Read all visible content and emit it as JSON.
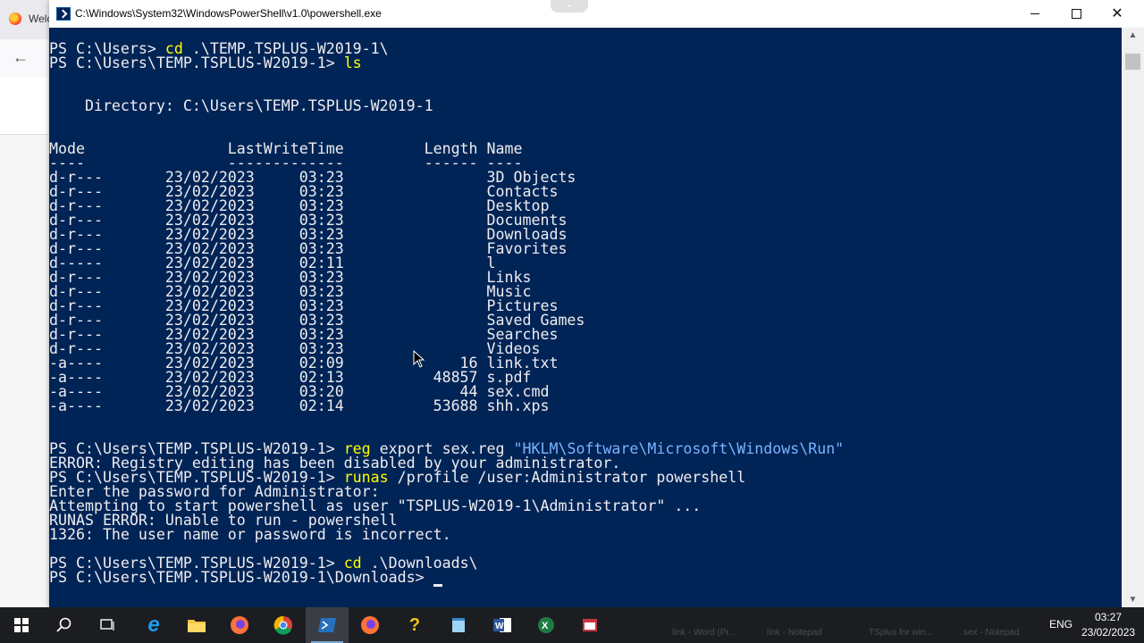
{
  "background_browser": {
    "tab_title": "Welc",
    "back_icon": "arrow-left-icon"
  },
  "window": {
    "title": "C:\\Windows\\System32\\WindowsPowerShell\\v1.0\\powershell.exe",
    "controls": {
      "minimize": "minimize-icon",
      "maximize": "maximize-icon",
      "close": "✕"
    }
  },
  "console": {
    "colors": {
      "background": "#012456",
      "text": "#eeedf0",
      "command": "#ffff00",
      "string": "#79b3ff"
    },
    "lines": [
      {
        "prompt": "",
        "rest": ""
      },
      {
        "prompt": "PS C:\\Users> ",
        "cmd": "cd",
        "rest": " .\\TEMP.TSPLUS-W2019-1\\"
      },
      {
        "prompt": "PS C:\\Users\\TEMP.TSPLUS-W2019-1> ",
        "cmd": "ls",
        "rest": ""
      },
      {
        "prompt": "",
        "rest": ""
      },
      {
        "prompt": "",
        "rest": ""
      },
      {
        "prompt": "",
        "rest": "    Directory: C:\\Users\\TEMP.TSPLUS-W2019-1"
      },
      {
        "prompt": "",
        "rest": ""
      },
      {
        "prompt": "",
        "rest": ""
      },
      {
        "prompt": "",
        "rest": "Mode                LastWriteTime         Length Name"
      },
      {
        "prompt": "",
        "rest": "----                -------------         ------ ----"
      },
      {
        "prompt": "",
        "rest": "d-r---       23/02/2023     03:23                3D Objects"
      },
      {
        "prompt": "",
        "rest": "d-r---       23/02/2023     03:23                Contacts"
      },
      {
        "prompt": "",
        "rest": "d-r---       23/02/2023     03:23                Desktop"
      },
      {
        "prompt": "",
        "rest": "d-r---       23/02/2023     03:23                Documents"
      },
      {
        "prompt": "",
        "rest": "d-r---       23/02/2023     03:23                Downloads"
      },
      {
        "prompt": "",
        "rest": "d-r---       23/02/2023     03:23                Favorites"
      },
      {
        "prompt": "",
        "rest": "d-----       23/02/2023     02:11                l"
      },
      {
        "prompt": "",
        "rest": "d-r---       23/02/2023     03:23                Links"
      },
      {
        "prompt": "",
        "rest": "d-r---       23/02/2023     03:23                Music"
      },
      {
        "prompt": "",
        "rest": "d-r---       23/02/2023     03:23                Pictures"
      },
      {
        "prompt": "",
        "rest": "d-r---       23/02/2023     03:23                Saved Games"
      },
      {
        "prompt": "",
        "rest": "d-r---       23/02/2023     03:23                Searches"
      },
      {
        "prompt": "",
        "rest": "d-r---       23/02/2023     03:23                Videos"
      },
      {
        "prompt": "",
        "rest": "-a----       23/02/2023     02:09             16 link.txt"
      },
      {
        "prompt": "",
        "rest": "-a----       23/02/2023     02:13          48857 s.pdf"
      },
      {
        "prompt": "",
        "rest": "-a----       23/02/2023     03:20             44 sex.cmd"
      },
      {
        "prompt": "",
        "rest": "-a----       23/02/2023     02:14          53688 shh.xps"
      },
      {
        "prompt": "",
        "rest": ""
      },
      {
        "prompt": "",
        "rest": ""
      },
      {
        "prompt": "PS C:\\Users\\TEMP.TSPLUS-W2019-1> ",
        "cmd": "reg",
        "rest": " export sex.reg ",
        "str": "\"HKLM\\Software\\Microsoft\\Windows\\Run\""
      },
      {
        "prompt": "",
        "rest": "ERROR: Registry editing has been disabled by your administrator."
      },
      {
        "prompt": "PS C:\\Users\\TEMP.TSPLUS-W2019-1> ",
        "cmd": "runas",
        "rest": " /profile /user:Administrator powershell"
      },
      {
        "prompt": "",
        "rest": "Enter the password for Administrator:"
      },
      {
        "prompt": "",
        "rest": "Attempting to start powershell as user \"TSPLUS-W2019-1\\Administrator\" ..."
      },
      {
        "prompt": "",
        "rest": "RUNAS ERROR: Unable to run - powershell"
      },
      {
        "prompt": "",
        "rest": "1326: The user name or password is incorrect."
      },
      {
        "prompt": "",
        "rest": ""
      },
      {
        "prompt": "PS C:\\Users\\TEMP.TSPLUS-W2019-1> ",
        "cmd": "cd",
        "rest": " .\\Downloads\\"
      },
      {
        "prompt": "PS C:\\Users\\TEMP.TSPLUS-W2019-1\\Downloads> ",
        "rest": "",
        "cursor": true
      }
    ]
  },
  "taskbar": {
    "items": [
      {
        "name": "start-button",
        "icon": "windows-logo-icon"
      },
      {
        "name": "search-button",
        "icon": "search-icon"
      },
      {
        "name": "task-view-button",
        "icon": "task-view-icon"
      },
      {
        "name": "edge-button",
        "icon": "internet-explorer-icon"
      },
      {
        "name": "file-explorer-button",
        "icon": "folder-icon"
      },
      {
        "name": "firefox-button",
        "icon": "firefox-icon"
      },
      {
        "name": "chrome-button",
        "icon": "chrome-icon"
      },
      {
        "name": "powershell-button",
        "icon": "powershell-icon",
        "active": true
      },
      {
        "name": "firefox-2-button",
        "icon": "firefox-icon"
      },
      {
        "name": "help-button",
        "icon": "help-icon"
      },
      {
        "name": "notepad-button",
        "icon": "notepad-icon"
      },
      {
        "name": "word-button",
        "icon": "word-icon"
      },
      {
        "name": "excel-button",
        "icon": "excel-icon"
      },
      {
        "name": "app-button",
        "icon": "app-icon"
      }
    ],
    "ghost_labels": [
      "link - Word (Pr...",
      "link - Notepad",
      "TSplus for win...",
      "sex - Notepad"
    ],
    "language": "ENG",
    "time": "03:27",
    "date": "23/02/2023"
  }
}
